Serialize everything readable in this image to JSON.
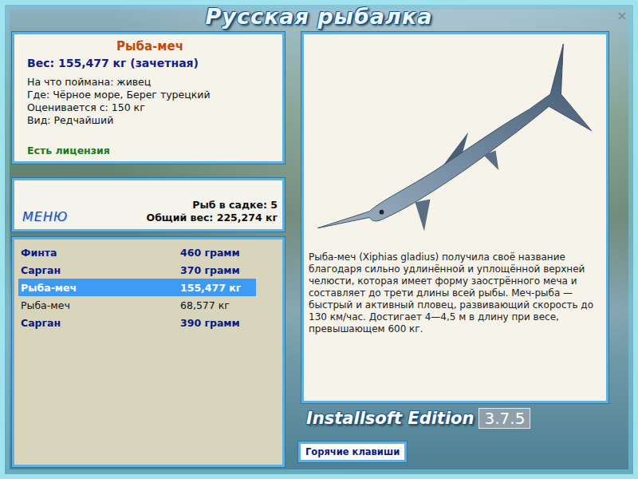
{
  "title": "Русская рыбалка",
  "catch": {
    "name": "Рыба-меч",
    "weight": "Вес: 155,477 кг (зачетная)",
    "details": [
      "На что поймана: живец",
      "Где: Чёрное море, Берег турецкий",
      "Оценивается с: 150 кг",
      "Вид: Редчайший"
    ],
    "license": "Есть лицензия"
  },
  "menu": {
    "label": "МЕНЮ",
    "count": "Рыб в садке: 5",
    "total": "Общий вес: 225,274 кг"
  },
  "keepnet": [
    {
      "name": "Финта",
      "weight": "460 грамм",
      "trophy": true,
      "selected": false
    },
    {
      "name": "Сарган",
      "weight": "370 грамм",
      "trophy": true,
      "selected": false
    },
    {
      "name": "Рыба-меч",
      "weight": "155,477 кг",
      "trophy": true,
      "selected": true
    },
    {
      "name": "Рыба-меч",
      "weight": "68,577 кг",
      "trophy": false,
      "selected": false
    },
    {
      "name": "Сарган",
      "weight": "390 грамм",
      "trophy": true,
      "selected": false
    }
  ],
  "description": "Рыба-меч (Xiphias gladius) получила своё название благодаря сильно удлинённой и уплощённой верхней челюсти, которая имеет форму заострённого меча и составляет до трети длины всей рыбы. Меч-рыба — быстрый и активный пловец, развивающий скорость до 130 км/час. Достигает 4—4,5 м в длину при весе, превышающем 600 кг.",
  "edition": {
    "label": "Installsoft Edition",
    "version": "3.7.5"
  },
  "hotkeys_button": "Горячие клавиши"
}
